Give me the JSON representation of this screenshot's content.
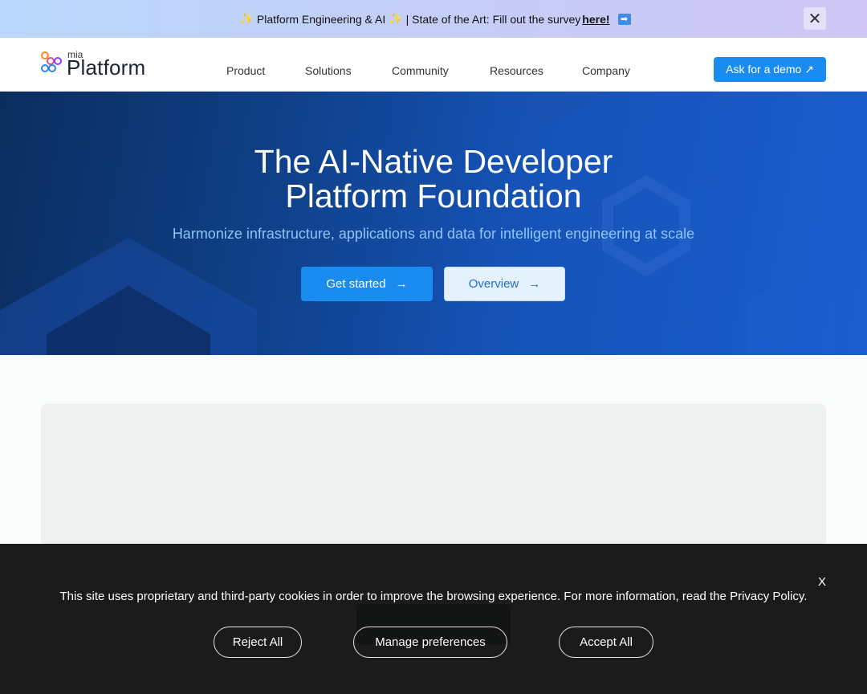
{
  "announcement": {
    "sparkle": "✨",
    "text": "Platform Engineering & AI",
    "separator": "| State of the Art: Fill out the survey",
    "link_label": "here!",
    "arrow": "➡",
    "close_glyph": "✕"
  },
  "header": {
    "logo_small": "mia",
    "logo_big": "Platform",
    "nav": [
      "Product",
      "Solutions",
      "Community",
      "Resources",
      "Company"
    ],
    "demo_label": "Ask for a demo ↗"
  },
  "hero": {
    "title_line1": "The AI-Native Developer",
    "title_line2": "Platform Foundation",
    "subtitle": "Harmonize infrastructure, applications and data for intelligent engineering at scale",
    "primary_label": "Get started",
    "secondary_label": "Overview",
    "arrow": "→"
  },
  "cookie": {
    "close": "X",
    "message": "This site uses proprietary and third-party cookies in order to improve the browsing experience. For more information, read the Privacy Policy.",
    "reject": "Reject All",
    "manage": "Manage preferences",
    "accept": "Accept All"
  },
  "colors": {
    "accent": "#1a8cf0",
    "hero_dark": "#0b2d5e",
    "hero_light": "#1b5dd0",
    "logo_orange": "#f28c28",
    "logo_purple": "#8a3ffc",
    "logo_blue": "#2f80ed"
  }
}
